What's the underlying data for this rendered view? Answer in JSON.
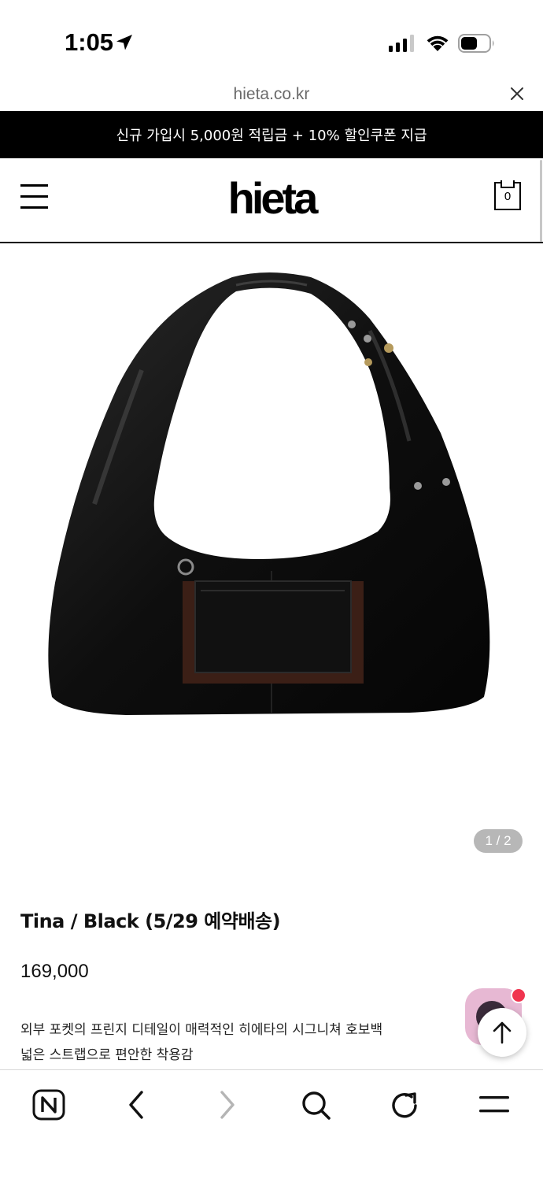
{
  "status_bar": {
    "time": "1:05"
  },
  "browser": {
    "url": "hieta.co.kr"
  },
  "promo": {
    "text": "신규 가입시 5,000원 적립금 + 10% 할인쿠폰 지급"
  },
  "header": {
    "logo": "hieta",
    "cart_count": "0"
  },
  "gallery": {
    "counter": "1 / 2"
  },
  "product": {
    "name": "Tina / Black (5/29 예약배송)",
    "price": "169,000",
    "description": [
      "외부 포켓의 프린지 디테일이 매력적인 히에타의 시그니쳐 호보백",
      "넓은 스트랩으로 편안한 착용감"
    ]
  },
  "toolbar": {
    "icons": [
      "naver-home-icon",
      "back-icon",
      "forward-icon",
      "search-icon",
      "reload-icon",
      "menu-icon"
    ]
  },
  "colors": {
    "banner_bg": "#000000",
    "chat_button": "#e7b8d3",
    "notify_dot": "#f0344f",
    "counter_bg": "#b7b7b7"
  }
}
